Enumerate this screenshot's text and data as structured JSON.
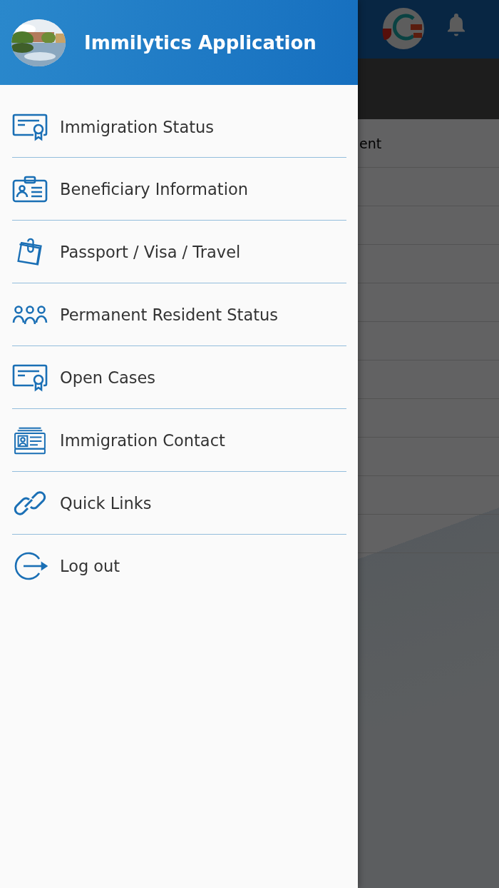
{
  "drawer": {
    "title": "Immilytics Application",
    "items": [
      {
        "label": "Immigration Status",
        "kind": "certificate"
      },
      {
        "label": "Beneficiary Information",
        "kind": "badge"
      },
      {
        "label": "Passport / Visa / Travel",
        "kind": "documents"
      },
      {
        "label": "Permanent Resident Status",
        "kind": "people"
      },
      {
        "label": "Open Cases",
        "kind": "certificate"
      },
      {
        "label": "Immigration Contact",
        "kind": "contact"
      },
      {
        "label": "Quick Links",
        "kind": "link"
      },
      {
        "label": "Log out",
        "kind": "logout"
      }
    ]
  },
  "background_page": {
    "list": [
      {
        "label": "ent"
      }
    ]
  }
}
